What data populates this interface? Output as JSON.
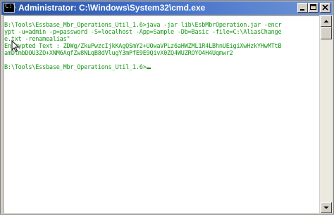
{
  "window": {
    "title": "Administrator: C:\\Windows\\System32\\cmd.exe",
    "icon": "cmd-icon",
    "controls": {
      "minimize": "minimize-icon",
      "maximize": "maximize-icon",
      "close": "close-icon"
    }
  },
  "console": {
    "lines": [
      "B:\\Tools\\Essbase_Mbr_Operations_Util_1.6>java -jar lib\\EsbMbrOperation.jar -encr",
      "ypt -u=admin -p=password -S=localhost -App=Sample -Db=Basic -file=C:\\AliasChange",
      "e.txt -renamealias\"",
      "Encrypted Text : ZDWg/ZkuPwzcIjkKAgQSmY2+UOwaVPLz6aHWZML1R4LBhnUEigiXwHzkYHwMTtB",
      "amDlmbDOU3ZO+XNM6AqfZw8NLqB8dVlugY3mPfE9E9QivX0ZQ4WUZROYO4H4Uqmwr2",
      "",
      "B:\\Tools\\Essbase_Mbr_Operations_Util_1.6>"
    ],
    "text_color": "#149614",
    "background": "#ffffff"
  },
  "scrollbar": {
    "up": "scroll-up-arrow-icon",
    "down": "scroll-down-arrow-icon"
  }
}
